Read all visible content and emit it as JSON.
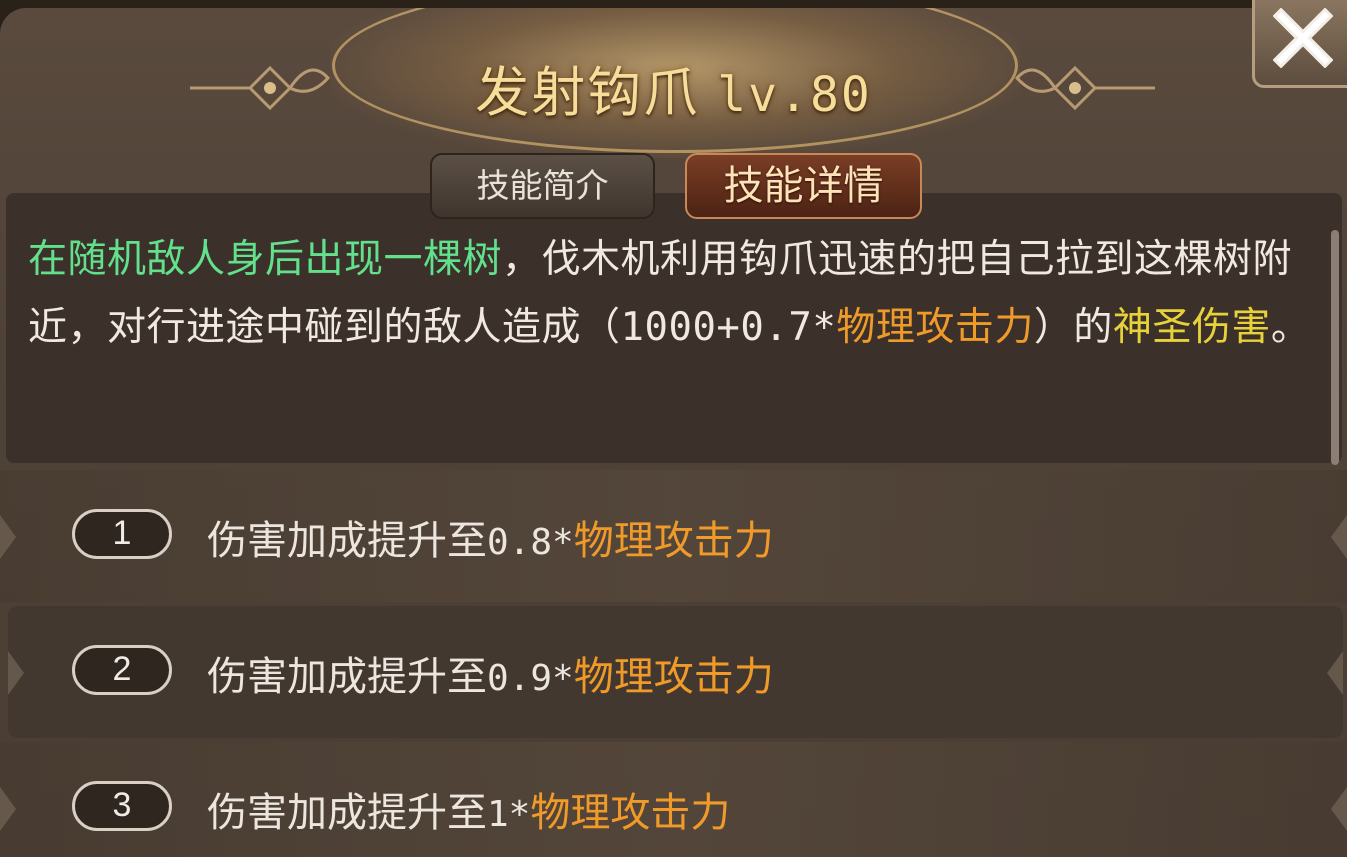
{
  "skill": {
    "name": "发射钩爪",
    "level": "lv.80"
  },
  "tabs": {
    "intro": "技能简介",
    "detail": "技能详情",
    "active": "detail"
  },
  "description": {
    "highlight": "在随机敌人身后出现一棵树",
    "part1": "，伐木机利用钩爪迅速的把自己拉到这棵树附近，对行进途中碰到的敌人造成（",
    "formula": "1000+0.7*",
    "stat": "物理攻击力",
    "part2": "）的",
    "damage_type": "神圣伤害",
    "end": "。"
  },
  "upgrades": [
    {
      "num": "1",
      "prefix": "伤害加成提升至",
      "value": "0.8*",
      "stat": "物理攻击力"
    },
    {
      "num": "2",
      "prefix": "伤害加成提升至",
      "value": "0.9*",
      "stat": "物理攻击力"
    },
    {
      "num": "3",
      "prefix": "伤害加成提升至",
      "value": "1*",
      "stat": "物理攻击力"
    }
  ],
  "colors": {
    "highlight_green": "#62e08c",
    "stat_orange": "#f09a2a",
    "damage_yellow": "#e8d23a",
    "title_gold": "#f6dd9a"
  },
  "icons": {
    "close": "close-icon"
  }
}
